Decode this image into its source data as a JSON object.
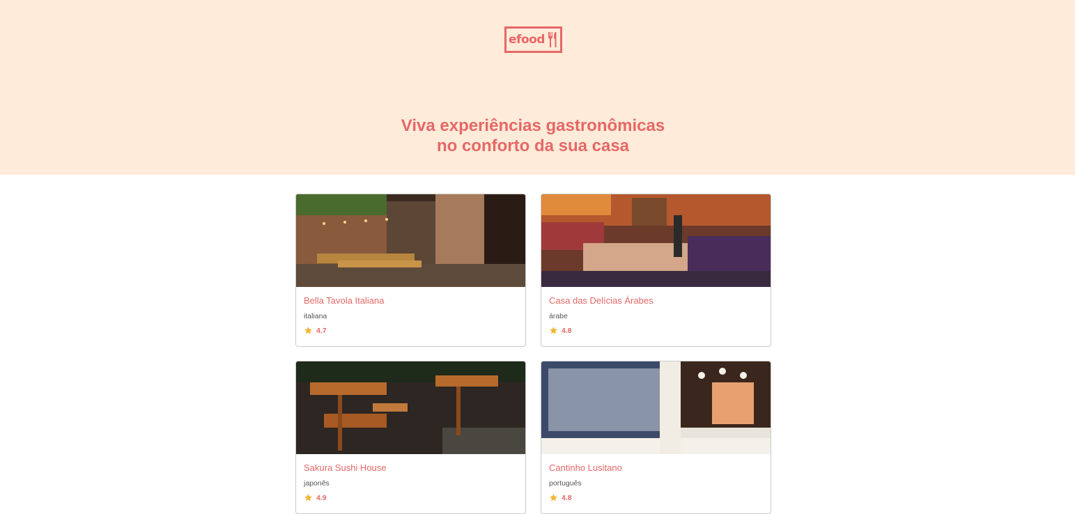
{
  "header": {
    "logo_text": "efood",
    "logo_icon": "fork-knife-icon",
    "headline_line1": "Viva experiências gastronômicas",
    "headline_line2": "no conforto da sua casa"
  },
  "colors": {
    "accent": "#e66767",
    "hero_bg": "#ffebd9",
    "star": "#f2b632"
  },
  "restaurants": [
    {
      "name": "Bella Tavola Italiana",
      "cuisine": "italiana",
      "rating": "4.7",
      "rating_icon": "star-icon"
    },
    {
      "name": "Casa das Delícias Árabes",
      "cuisine": "árabe",
      "rating": "4.8",
      "rating_icon": "star-icon"
    },
    {
      "name": "Sakura Sushi House",
      "cuisine": "japonês",
      "rating": "4.9",
      "rating_icon": "star-icon"
    },
    {
      "name": "Cantinho Lusitano",
      "cuisine": "português",
      "rating": "4.8",
      "rating_icon": "star-icon"
    }
  ]
}
